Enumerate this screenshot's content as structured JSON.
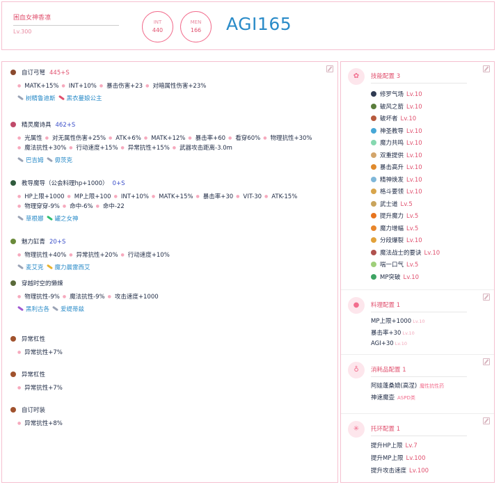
{
  "character": {
    "name": "困血女神香凛",
    "level": "Lv.300",
    "stats": [
      {
        "label": "INT",
        "value": "440"
      },
      {
        "label": "MEN",
        "value": "166"
      }
    ],
    "main_stat": "AGI165"
  },
  "equipment": [
    {
      "name": "自订弓弩",
      "refine": "445+S",
      "stats": [
        "MATK+15%",
        "INT+10%",
        "暴击伤害+23",
        "对暗属性伤害+23%"
      ],
      "gems": [
        {
          "name": "树精鲁迪斯",
          "color": "#9aa3b5"
        },
        {
          "name": "黑衣蔓娘公主",
          "color": "#e0506e"
        }
      ]
    },
    {
      "name": "精灵魔诗具",
      "refine": "462+S",
      "stats": [
        "光属性",
        "对无属性伤害+25%",
        "ATK+6%",
        "MATK+12%",
        "暴击率+60",
        "看穿60%",
        "物理抗性+30%",
        "魔法抗性+30%",
        "行动速度+15%",
        "异常抗性+15%",
        "武器攻击距离-3.0m"
      ],
      "gems": [
        {
          "name": "巴吉姆",
          "color": "#9aa3b5"
        },
        {
          "name": "毋茨克",
          "color": "#9aa3b5"
        }
      ]
    },
    {
      "name": "教导魔导（公会料理hp+1000）",
      "refine": "0+S",
      "stats": [
        "HP上限+1000",
        "MP上限+100",
        "INT+10%",
        "MATK+15%",
        "暴击率+30",
        "VIT-30",
        "ATK-15%",
        "物理穿穿-9%",
        "命中-6%",
        "命中-22"
      ],
      "gems": [
        {
          "name": "草根娜",
          "color": "#9aa3b5"
        },
        {
          "name": "罐之女神",
          "color": "#2fbf71"
        }
      ]
    },
    {
      "name": "魅力缸青",
      "refine": "20+S",
      "stats": [
        "物理抗性+40%",
        "异常抗性+20%",
        "行动速度+10%"
      ],
      "gems": [
        {
          "name": "麦艾克",
          "color": "#9aa3b5"
        },
        {
          "name": "魔力晨雷西艾",
          "color": "#e7b22e"
        }
      ]
    },
    {
      "name": "穿越时空的懒辣",
      "refine": "",
      "stats": [
        "物理抗性-9%",
        "魔法抗性-9%",
        "攻击速度+1000"
      ],
      "gems": [
        {
          "name": "黑利古各",
          "color": "#a05ad2"
        },
        {
          "name": "爱缇蒂兹",
          "color": "#9aa3b5"
        }
      ]
    },
    {
      "name": "异常杠性",
      "refine": "",
      "stats": [
        "异常抗性+7%"
      ],
      "gems": []
    },
    {
      "name": "异常杠性",
      "refine": "",
      "stats": [
        "异常抗性+7%"
      ],
      "gems": []
    },
    {
      "name": "自订时装",
      "refine": "",
      "stats": [
        "异常抗性+8%"
      ],
      "gems": []
    }
  ],
  "skills": {
    "title": "技能配置 3",
    "items": [
      {
        "name": "修罗气场",
        "level": "Lv.10",
        "color": "#2f3b52"
      },
      {
        "name": "破风之箭",
        "level": "Lv.10",
        "color": "#5a7d3c"
      },
      {
        "name": "破坏者",
        "level": "Lv.10",
        "color": "#b75a3d"
      },
      {
        "name": "神圣教导",
        "level": "Lv.10",
        "color": "#46a7d6"
      },
      {
        "name": "魔力共鸣",
        "level": "Lv.10",
        "color": "#86d8b0"
      },
      {
        "name": "双重提供",
        "level": "Lv.10",
        "color": "#d3a56b"
      },
      {
        "name": "暴击高升",
        "level": "Lv.10",
        "color": "#e08a2c"
      },
      {
        "name": "精神焕发",
        "level": "Lv.10",
        "color": "#7fb7d9"
      },
      {
        "name": "格斗要领",
        "level": "Lv.10",
        "color": "#d8a54b"
      },
      {
        "name": "武士道",
        "level": "Lv.5",
        "color": "#c9a45c"
      },
      {
        "name": "提升魔力",
        "level": "Lv.5",
        "color": "#e7741e"
      },
      {
        "name": "魔力增幅",
        "level": "Lv.5",
        "color": "#e8862b"
      },
      {
        "name": "分段爆裂",
        "level": "Lv.10",
        "color": "#e2a13a"
      },
      {
        "name": "魔法战士的要诀",
        "level": "Lv.10",
        "color": "#b0524e"
      },
      {
        "name": "喘一口气",
        "level": "Lv.5",
        "color": "#9fcf7a"
      },
      {
        "name": "MP突破",
        "level": "Lv.10",
        "color": "#3ea463"
      }
    ]
  },
  "food": {
    "title": "料理配置 1",
    "items": [
      {
        "name": "MP上限+1000",
        "level": "Lv.10"
      },
      {
        "name": "暴击率+30",
        "level": "Lv.10"
      },
      {
        "name": "AGI+30",
        "level": "Lv.10"
      }
    ]
  },
  "consumables": {
    "title": "消耗品配置 1",
    "items": [
      {
        "name": "阿娃蓬桑媲(高涅)",
        "tag": "魔性抗性药"
      },
      {
        "name": "神速魔壶",
        "tag": "ASPD类"
      }
    ]
  },
  "registlets": {
    "title": "托环配置 1",
    "items": [
      {
        "name": "提升HP上限",
        "level": "Lv.7"
      },
      {
        "name": "提升MP上限",
        "level": "Lv.100"
      },
      {
        "name": "提升攻击速度",
        "level": "Lv.100"
      }
    ]
  },
  "icons": {
    "skills": "skill-tree-icon",
    "food": "food-icon",
    "consumables": "potion-icon",
    "registlets": "ring-icon",
    "edit": "edit-icon"
  },
  "colors": {
    "accent": "#f26d8d",
    "accent_dark": "#e0506e",
    "border": "#f5bfcf",
    "main_stat": "#2a8bc8",
    "refine": "#3a4ec9"
  }
}
